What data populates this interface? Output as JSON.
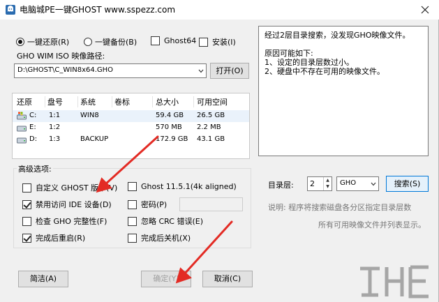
{
  "window": {
    "title": "电脑城PE一键GHOST  www.sspezz.com",
    "close_glyph": "✕"
  },
  "mode": {
    "restore_label": "一键还原(R)",
    "backup_label": "一键备份(B)",
    "ghost64_label": "Ghost64",
    "install_label": "安装(I)",
    "selected": "restore"
  },
  "path": {
    "label": "GHO WIM ISO 映像路径:",
    "value": "D:\\GHOST\\C_WIN8x64.GHO",
    "open_button": "打开(O)"
  },
  "partitions": {
    "headers": [
      "还原",
      "盘号",
      "系统",
      "卷标",
      "总大小",
      "可用空间"
    ],
    "rows": [
      {
        "drive": "C:",
        "disk": "1:1",
        "system": "WIN8",
        "label": "",
        "total": "59.4 GB",
        "free": "26.5 GB",
        "icon": "windows-drive-icon"
      },
      {
        "drive": "E:",
        "disk": "1:2",
        "system": "",
        "label": "",
        "total": "570 MB",
        "free": "2.2 MB",
        "icon": "drive-icon"
      },
      {
        "drive": "D:",
        "disk": "1:3",
        "system": "BACKUP",
        "label": "",
        "total": "172.9 GB",
        "free": "43.1 GB",
        "icon": "drive-icon"
      }
    ]
  },
  "advanced": {
    "title": "高级选项:",
    "custom_ghost": {
      "label": "自定义 GHOST 版本(V)",
      "checked": false
    },
    "disable_ide": {
      "label": "禁用访问 IDE 设备(D)",
      "checked": true
    },
    "check_gho": {
      "label": "检查 GHO 完整性(F)",
      "checked": false
    },
    "reboot": {
      "label": "完成后重启(R)",
      "checked": true
    },
    "ghost_version": {
      "label": "Ghost 11.5.1(4k aligned)",
      "checked": false
    },
    "password": {
      "label": "密码(P)",
      "checked": false,
      "value": ""
    },
    "ignore_crc": {
      "label": "忽略 CRC 错误(E)",
      "checked": false
    },
    "shutdown": {
      "label": "完成后关机(X)",
      "checked": false
    }
  },
  "buttons": {
    "simple": "简洁(A)",
    "ok": "确定(Y)",
    "cancel": "取消(C)"
  },
  "log": {
    "lines": [
      "经过2层目录搜索，没发现GHO映像文件。",
      "",
      "原因可能如下:",
      "1、设定的目录层数过小。",
      "2、硬盘中不存在可用的映像文件。"
    ]
  },
  "search": {
    "depth_label": "目录层:",
    "depth_value": "2",
    "type_value": "GHO",
    "search_button": "搜索(S)"
  },
  "hint": {
    "line1": "说明: 程序将搜索磁盘各分区指定目录层数",
    "line2": "所有可用映像文件并列表显示。"
  },
  "colors": {
    "annotation_arrow": "#e32b24",
    "client_bg": "#f0f0f0",
    "selected_row": "#eaf2fb",
    "disabled_text": "#a0a0a0"
  }
}
